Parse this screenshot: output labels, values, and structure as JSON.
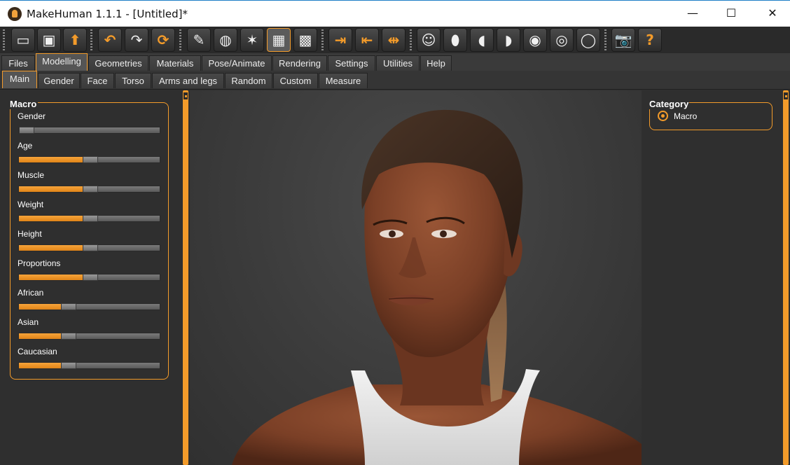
{
  "window": {
    "title": "MakeHuman 1.1.1 - [Untitled]*",
    "minimize": "—",
    "maximize": "☐",
    "close": "✕"
  },
  "toolbar": {
    "buttons": [
      {
        "name": "load-button",
        "glyph": "▭"
      },
      {
        "name": "save-button",
        "glyph": "▣"
      },
      {
        "name": "export-button",
        "glyph": "⬆"
      },
      {
        "name": "undo-button",
        "glyph": "↶"
      },
      {
        "name": "redo-button",
        "glyph": "↷"
      },
      {
        "name": "reset-button",
        "glyph": "⟳"
      },
      {
        "name": "smooth-button",
        "glyph": "✎"
      },
      {
        "name": "wireframe-button",
        "glyph": "◍"
      },
      {
        "name": "pose-button",
        "glyph": "✶"
      },
      {
        "name": "grid-button",
        "glyph": "▦"
      },
      {
        "name": "background-button",
        "glyph": "▩"
      },
      {
        "name": "front-view-button",
        "glyph": "⇥"
      },
      {
        "name": "back-view-button",
        "glyph": "⇤"
      },
      {
        "name": "side-view-button",
        "glyph": "⇹"
      },
      {
        "name": "face-view-button",
        "glyph": "☺"
      },
      {
        "name": "head-front-button",
        "glyph": "⬮"
      },
      {
        "name": "head-left-button",
        "glyph": "◖"
      },
      {
        "name": "head-right-button",
        "glyph": "◗"
      },
      {
        "name": "top-view-button",
        "glyph": "◉"
      },
      {
        "name": "bottom-view-button",
        "glyph": "◎"
      },
      {
        "name": "reset-camera-button",
        "glyph": "◯"
      },
      {
        "name": "screenshot-button",
        "glyph": "📷"
      },
      {
        "name": "help-button",
        "glyph": "?"
      }
    ]
  },
  "tabs": {
    "main": [
      "Files",
      "Modelling",
      "Geometries",
      "Materials",
      "Pose/Animate",
      "Rendering",
      "Settings",
      "Utilities",
      "Help"
    ],
    "selected_main": "Modelling",
    "sub": [
      "Main",
      "Gender",
      "Face",
      "Torso",
      "Arms and legs",
      "Random",
      "Custom",
      "Measure"
    ],
    "selected_sub": "Main"
  },
  "macro": {
    "title": "Macro",
    "sliders": [
      {
        "label": "Gender",
        "value": 0.0
      },
      {
        "label": "Age",
        "value": 0.5
      },
      {
        "label": "Muscle",
        "value": 0.5
      },
      {
        "label": "Weight",
        "value": 0.5
      },
      {
        "label": "Height",
        "value": 0.5
      },
      {
        "label": "Proportions",
        "value": 0.5
      },
      {
        "label": "African",
        "value": 0.333
      },
      {
        "label": "Asian",
        "value": 0.333
      },
      {
        "label": "Caucasian",
        "value": 0.333
      }
    ]
  },
  "category": {
    "title": "Category",
    "option": "Macro"
  },
  "colors": {
    "accent": "#f39b2a",
    "panel": "#2f2f2f",
    "viewport": "#3b3b3b"
  }
}
